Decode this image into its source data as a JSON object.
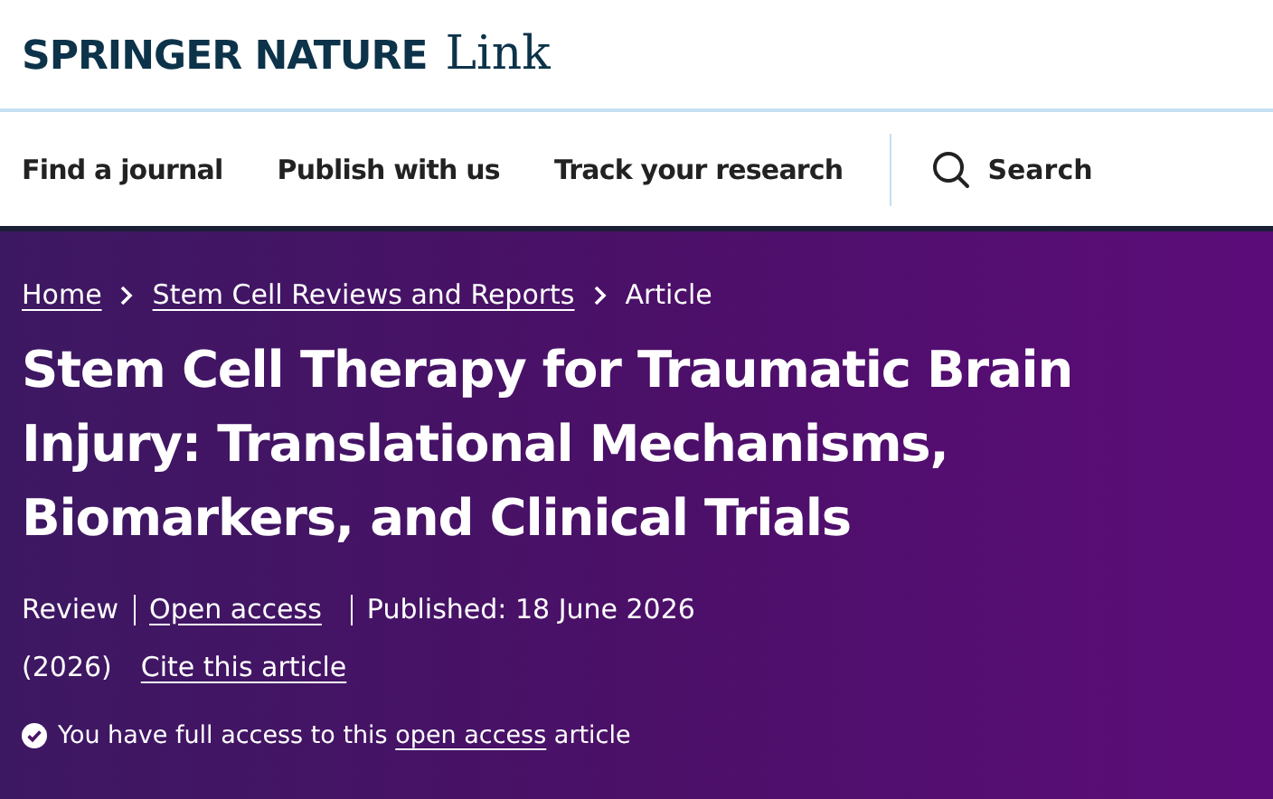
{
  "logo": {
    "brand": "SPRINGER NATURE",
    "product": "Link"
  },
  "nav": {
    "items": [
      "Find a journal",
      "Publish with us",
      "Track your research"
    ],
    "search": "Search"
  },
  "breadcrumb": [
    {
      "label": "Home",
      "kind": "link"
    },
    {
      "label": "Stem Cell Reviews and Reports",
      "kind": "link"
    },
    {
      "label": "Article",
      "kind": "text"
    }
  ],
  "title": "Stem Cell Therapy for Traumatic Brain Injury: Translational Mechanisms, Biomarkers, and Clinical Trials",
  "meta_lines": [
    [
      {
        "label": "Review",
        "kind": "text"
      },
      {
        "label": "Open access",
        "kind": "link"
      },
      {
        "label": "Published: 18 June 2026",
        "kind": "text"
      }
    ],
    [
      {
        "label": "(2026)",
        "kind": "text"
      },
      {
        "label": "Cite this article",
        "kind": "link"
      }
    ]
  ],
  "access_notice": {
    "before": "You have full access to this ",
    "link": "open access",
    "after": " article"
  }
}
